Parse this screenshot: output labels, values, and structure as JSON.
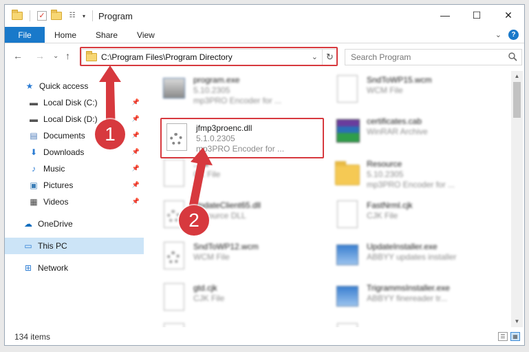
{
  "window": {
    "title": "Program"
  },
  "ribbon": {
    "tabs": [
      "File",
      "Home",
      "Share",
      "View"
    ]
  },
  "address": {
    "path": "C:\\Program Files\\Program Directory"
  },
  "search": {
    "placeholder": "Search Program"
  },
  "nav": {
    "items": [
      {
        "label": "Quick access",
        "icon": "star-icon",
        "pinned": false
      },
      {
        "label": "Local Disk (C:)",
        "icon": "drive-icon",
        "pinned": true
      },
      {
        "label": "Local Disk (D:)",
        "icon": "drive-icon",
        "pinned": true
      },
      {
        "label": "Documents",
        "icon": "documents-icon",
        "pinned": true
      },
      {
        "label": "Downloads",
        "icon": "download-icon",
        "pinned": true
      },
      {
        "label": "Music",
        "icon": "music-icon",
        "pinned": true
      },
      {
        "label": "Pictures",
        "icon": "pictures-icon",
        "pinned": true
      },
      {
        "label": "Videos",
        "icon": "videos-icon",
        "pinned": true
      },
      {
        "label": "OneDrive",
        "icon": "onedrive-icon"
      },
      {
        "label": "This PC",
        "icon": "pc-icon",
        "selected": true
      },
      {
        "label": "Network",
        "icon": "network-icon"
      }
    ]
  },
  "files": [
    {
      "name": "program.exe",
      "line2": "5.10.2305",
      "line3": "mp3PRO Encoder for ...",
      "icon": "exe-icon"
    },
    {
      "name": "SndToWP15.wcm",
      "line2": "WCM File",
      "icon": "file-icon"
    },
    {
      "name": "jfmp3proenc.dll",
      "line2": "5.1.0.2305",
      "line3": "mp3PRO Encoder for ...",
      "icon": "dll-gear-icon",
      "highlighted": true
    },
    {
      "name": "certificates.cab",
      "line2": "WinRAR Archive",
      "icon": "winrar-icon"
    },
    {
      "name": "...ck",
      "line2": "CK File",
      "icon": "file-icon"
    },
    {
      "name": "Resource",
      "line2": "5.10.2305",
      "line3": "mp3PRO Encoder for ...",
      "icon": "folder-icon"
    },
    {
      "name": "UpdateClient65.dll",
      "line2": "Resource DLL",
      "icon": "dll-icon"
    },
    {
      "name": "FastNrml.cjk",
      "line2": "CJK File",
      "icon": "file-icon"
    },
    {
      "name": "SndToWP12.wcm",
      "line2": "WCM File",
      "icon": "gear-file-icon"
    },
    {
      "name": "UpdateInstaller.exe",
      "line2": "ABBYY updates installer",
      "icon": "app-icon"
    },
    {
      "name": "gtd.cjk",
      "line2": "CJK File",
      "icon": "file-icon"
    },
    {
      "name": "TrigrammsInstaller.exe",
      "line2": "ABBYY finereader tr...",
      "icon": "app-icon"
    },
    {
      "name": "",
      "line2": "",
      "icon": "gear-file-icon"
    },
    {
      "name": "",
      "line2": "",
      "icon": "file-icon"
    }
  ],
  "status": {
    "items_count": "134 items"
  },
  "annotations": {
    "step1": "1",
    "step2": "2"
  },
  "colors": {
    "accent": "#1979ca",
    "highlight": "#d7393e",
    "selected_bg": "#cce4f7"
  }
}
